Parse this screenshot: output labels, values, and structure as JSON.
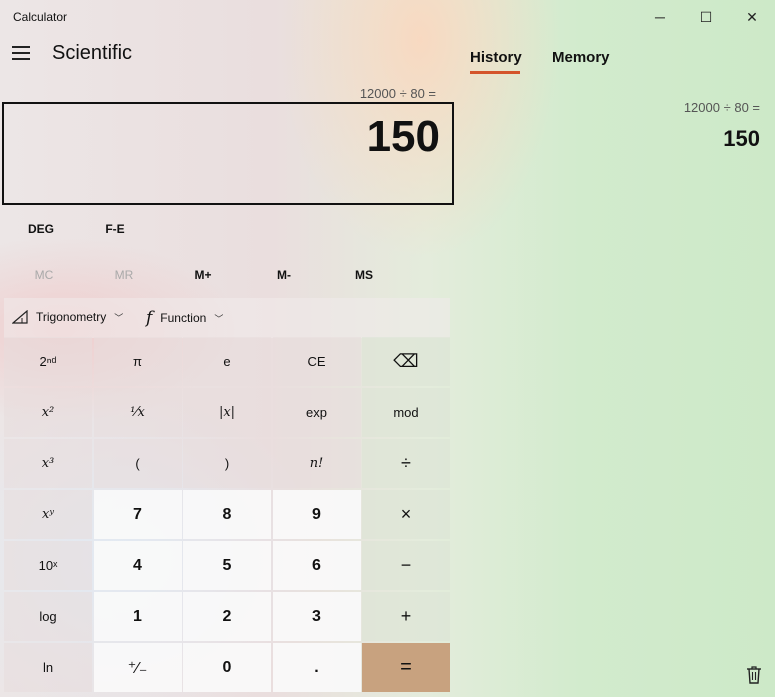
{
  "window": {
    "title": "Calculator",
    "controls": {
      "minimize": "─",
      "maximize": "☐",
      "close": "✕"
    }
  },
  "header": {
    "mode": "Scientific",
    "menu_icon": "hamburger-menu-icon"
  },
  "display": {
    "expression": "12000 ÷ 80 =",
    "value": "150"
  },
  "mode_row": {
    "angle_unit": "DEG",
    "notation": "F-E"
  },
  "memory_row": [
    {
      "label": "MC",
      "enabled": false
    },
    {
      "label": "MR",
      "enabled": false
    },
    {
      "label": "M+",
      "enabled": true
    },
    {
      "label": "M-",
      "enabled": true
    },
    {
      "label": "MS",
      "enabled": true
    }
  ],
  "function_row": {
    "trigonometry": "Trigonometry",
    "function": "Function",
    "trig_icon": "triangle-ruler-icon",
    "function_icon": "function-f-icon"
  },
  "keypad": {
    "row1": [
      "2ⁿᵈ",
      "π",
      "e",
      "CE",
      "⌫"
    ],
    "row2": [
      "x²",
      "¹⁄x",
      "|x|",
      "exp",
      "mod"
    ],
    "row3": [
      "x³",
      "(",
      ")",
      "n!",
      "÷"
    ],
    "row4": [
      "xʸ",
      "7",
      "8",
      "9",
      "×"
    ],
    "row5": [
      "10ˣ",
      "4",
      "5",
      "6",
      "−"
    ],
    "row6": [
      "log",
      "1",
      "2",
      "3",
      "+"
    ],
    "row7": [
      "ln",
      "⁺∕₋",
      "0",
      ".",
      "="
    ]
  },
  "right_pane": {
    "tabs": [
      "History",
      "Memory"
    ],
    "active_tab": "History",
    "history": [
      {
        "expression": "12000   ÷   80 =",
        "result": "150"
      }
    ],
    "clear_icon": "trash-icon"
  },
  "colors": {
    "accent_underline": "#d4542b",
    "equals_key": "#c8a27f",
    "number_key": "#fafafa"
  }
}
